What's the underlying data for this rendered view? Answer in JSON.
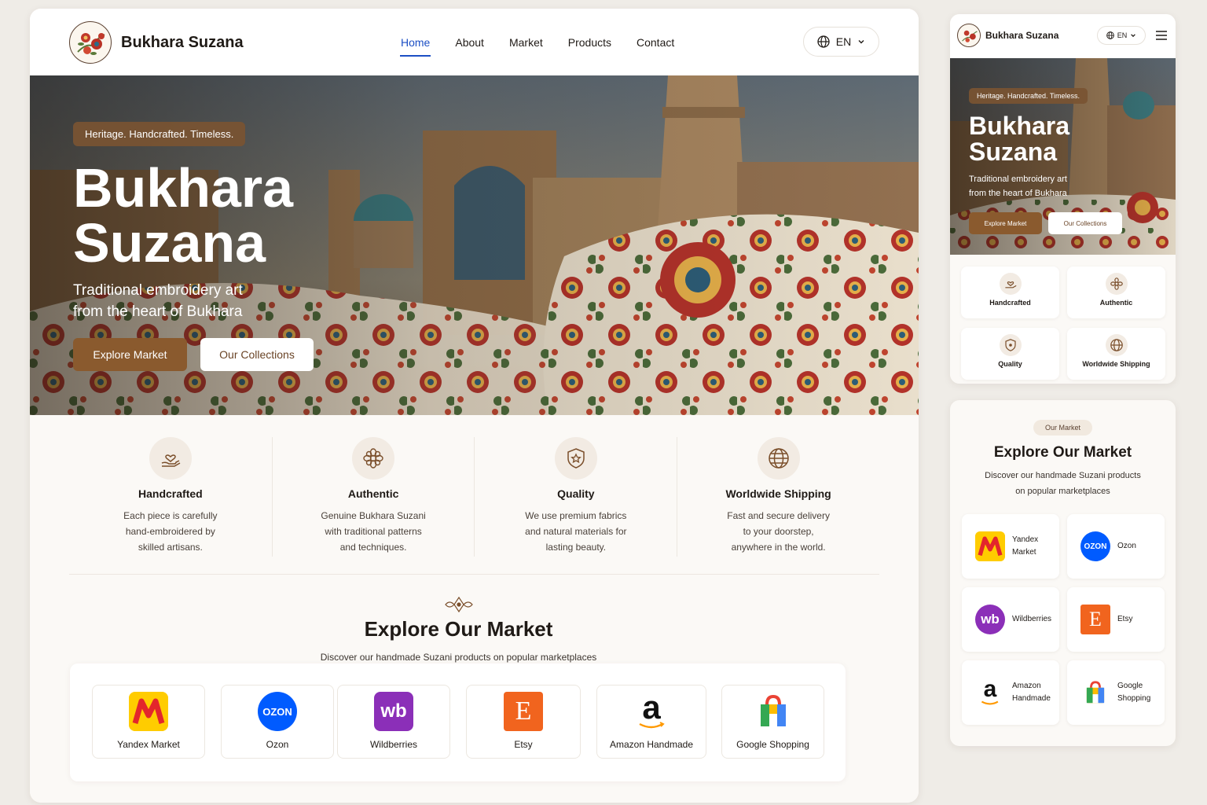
{
  "brand": {
    "name": "Bukhara Suzana"
  },
  "nav": {
    "items": [
      {
        "label": "Home",
        "active": true
      },
      {
        "label": "About"
      },
      {
        "label": "Market"
      },
      {
        "label": "Products"
      },
      {
        "label": "Contact"
      }
    ],
    "language": "EN"
  },
  "hero": {
    "tagline": "Heritage. Handcrafted. Timeless.",
    "title_line1": "Bukhara",
    "title_line2": "Suzana",
    "subtitle_line1": "Traditional embroidery art",
    "subtitle_line2": "from the heart of Bukhara",
    "primary_button": "Explore Market",
    "secondary_button": "Our Collections"
  },
  "features": [
    {
      "icon": "hand-heart-icon",
      "title": "Handcrafted",
      "desc_lines": [
        "Each piece is carefully",
        "hand-embroidered by",
        "skilled artisans."
      ]
    },
    {
      "icon": "flower-icon",
      "title": "Authentic",
      "desc_lines": [
        "Genuine Bukhara Suzani",
        "with traditional patterns",
        "and techniques."
      ]
    },
    {
      "icon": "shield-star-icon",
      "title": "Quality",
      "desc_lines": [
        "We use premium fabrics",
        "and natural materials for",
        "lasting beauty."
      ]
    },
    {
      "icon": "globe-icon",
      "title": "Worldwide Shipping",
      "desc_lines": [
        "Fast and secure delivery",
        "to your doorstep,",
        "anywhere in the world."
      ]
    }
  ],
  "market_section": {
    "badge": "Our Market",
    "title": "Explore Our Market",
    "subtitle": "Discover our handmade Suzani products on popular marketplaces",
    "mobile_subtitle_line1": "Discover our handmade Suzani products",
    "mobile_subtitle_line2": "on popular marketplaces"
  },
  "marketplaces": [
    {
      "name": "Yandex Market",
      "mobile_line1": "Yandex",
      "mobile_line2": "Market",
      "logo_text": "M",
      "color": "#ffcc00",
      "accent": "#e3262c"
    },
    {
      "name": "Ozon",
      "mobile_line1": "Ozon",
      "mobile_line2": "",
      "logo_text": "OZON",
      "color": "#005bff"
    },
    {
      "name": "Wildberries",
      "mobile_line1": "Wildberries",
      "mobile_line2": "",
      "logo_text": "wb",
      "color": "#8b2fb8"
    },
    {
      "name": "Etsy",
      "mobile_line1": "Etsy",
      "mobile_line2": "",
      "logo_text": "E",
      "color": "#f1641e"
    },
    {
      "name": "Amazon Handmade",
      "mobile_line1": "Amazon",
      "mobile_line2": "Handmade",
      "logo_text": "a",
      "color": "#ffffff"
    },
    {
      "name": "Google Shopping",
      "mobile_line1": "Google",
      "mobile_line2": "Shopping",
      "logo_text": "",
      "color": "#ffffff"
    }
  ],
  "colors": {
    "accent_brown": "#8a5a2e",
    "nav_active": "#1c4fc4",
    "background": "#efece7"
  }
}
